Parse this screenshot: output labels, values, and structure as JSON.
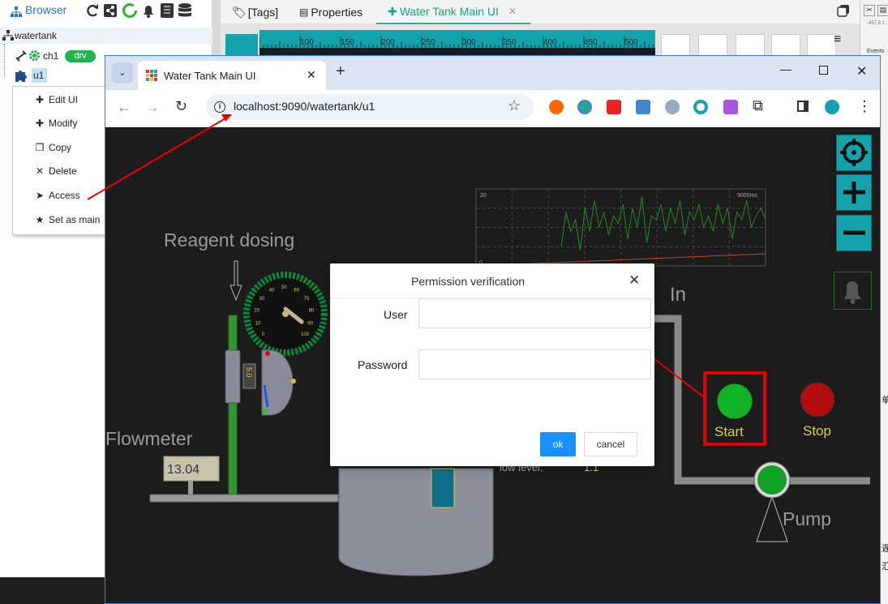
{
  "browser_panel": {
    "title": "Browser",
    "tree": {
      "root": "watertank",
      "child1": "ch1",
      "child1_badge": "drv",
      "child2": "u1"
    }
  },
  "context_menu": {
    "items": [
      "Edit UI",
      "Modify",
      "Copy",
      "Delete",
      "Access",
      "Set as main"
    ]
  },
  "editor_tabs": {
    "tags": "[Tags]",
    "properties": "Properties",
    "main": "Water Tank Main UI",
    "close": "✕"
  },
  "ruler_ticks": [
    "100",
    "150",
    "200",
    "250",
    "300",
    "350",
    "400",
    "450",
    "500",
    "550"
  ],
  "right_strip": {
    "events_label": "Events",
    "coord": "-457,8 1",
    "side_char1": "单",
    "side_char2": "遅",
    "side_char3": "汇"
  },
  "chrome": {
    "tab_title": "Water Tank Main UI",
    "address": "localhost:9090/watertank/u1"
  },
  "scada": {
    "reagent_label": "Reagent dosing",
    "flowmeter_label": "Flowmeter",
    "flow_value": "13.04",
    "in_label": "In",
    "start_label": "Start",
    "stop_label": "Stop",
    "pump_label": "Pump",
    "low_level_label": "low  level:",
    "low_level_value": "1.1",
    "gauge_ticks": [
      "0",
      "10",
      "20",
      "30",
      "40",
      "50",
      "60",
      "70",
      "80",
      "90",
      "100"
    ],
    "valve_value": "5.0",
    "trend_ymax": "20",
    "trend_ymin": "0",
    "trend_xlabel": "5000ms",
    "trend_values": [
      5,
      14,
      9,
      12,
      4,
      15,
      9,
      17,
      10,
      14,
      8,
      13,
      11,
      16,
      7,
      15,
      10,
      18,
      6,
      13,
      12,
      16,
      9,
      15,
      11,
      17,
      8,
      14,
      12,
      16,
      10,
      13,
      9,
      16,
      11,
      15,
      7,
      14,
      12,
      17,
      10,
      13,
      15,
      12
    ],
    "colors": {
      "bg": "#1c1c1c",
      "start": "#12b228",
      "stop": "#b20c0c",
      "highlight": "#e00000",
      "pipe_green": "#2a9a2a",
      "teal": "#14a3ad"
    }
  },
  "dialog": {
    "title": "Permission verification",
    "user_label": "User",
    "password_label": "Password",
    "ok": "ok",
    "cancel": "cancel",
    "user_value": "",
    "password_value": ""
  }
}
